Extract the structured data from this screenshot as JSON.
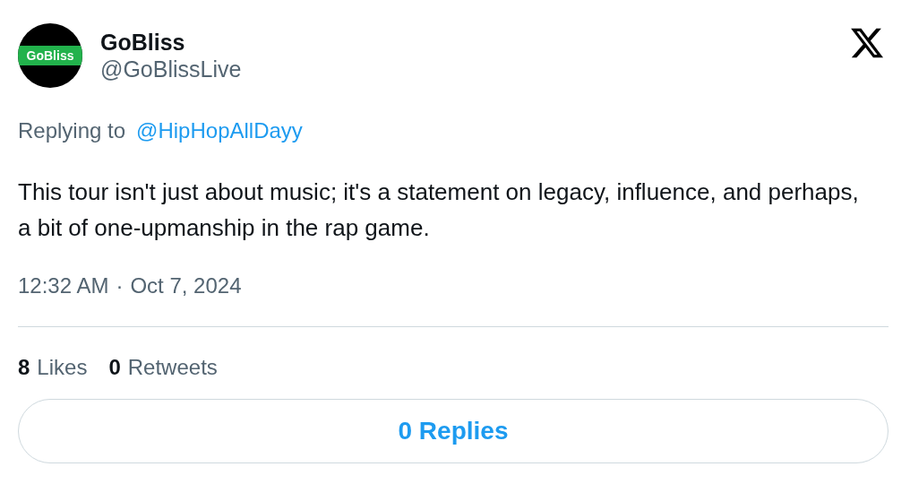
{
  "author": {
    "logo_text": "GoBliss",
    "name": "GoBliss",
    "handle": "@GoBlissLive"
  },
  "reply_to": {
    "label": "Replying to",
    "handle": "@HipHopAllDayy"
  },
  "text": "This tour isn't just about music; it's a statement on legacy, influence, and perhaps, a bit of one-upmanship in the rap game.",
  "time": "12:32 AM",
  "separator": "·",
  "date": "Oct 7, 2024",
  "stats": [
    {
      "count": "8",
      "label": "Likes"
    },
    {
      "count": "0",
      "label": "Retweets"
    }
  ],
  "replies_button": "0 Replies"
}
